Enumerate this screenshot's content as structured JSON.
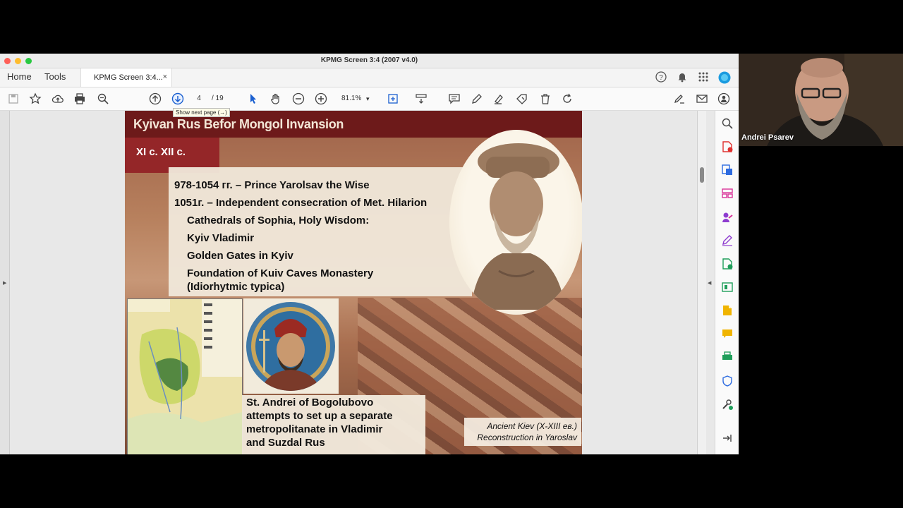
{
  "window": {
    "title": "KPMG Screen 3:4 (2007 v4.0)"
  },
  "tabs": {
    "home": "Home",
    "tools": "Tools",
    "document": "KPMG Screen 3:4...",
    "close": "×"
  },
  "toolbar": {
    "current_page": "4",
    "total_pages": "/ 19",
    "zoom": "81.1%",
    "zoom_caret": "▾",
    "tooltip": "Show next page (→)"
  },
  "slide": {
    "header": "Kyivan Rus Befor Mongol Invansion",
    "century_label": "XI c. XII c.",
    "lines": [
      "978-1054  гг. – Prince Yarolsav the Wise",
      "1051г. – Independent consecration of Met. Hilarion",
      "Cathedrals of Sophia, Holy Wisdom:",
      "Kyiv Vladimir",
      "Golden Gates in Kyiv",
      "Foundation of Kuiv Caves Monastery",
      "(Idiorhytmic typica)"
    ],
    "bottom_text": [
      "St. Andrei of Bogolubovo",
      "attempts to set up a separate",
      "metropolitanate in Vladimir",
      "and Suzdal Rus"
    ],
    "caption": [
      "Ancient Kiev (X-XIII ев.)",
      "Reconstruction in Yaroslav"
    ]
  },
  "video": {
    "participant_name": "Andrei Psarev"
  },
  "colors": {
    "header_bg": "#6d1a1a",
    "century_bg": "#942628",
    "accent_blue": "#1a73e8"
  },
  "icons": {
    "toolbar": [
      "save-icon",
      "bookmark-star-icon",
      "upload-cloud-icon",
      "print-icon",
      "search-zoom-icon",
      "prev-page-icon",
      "next-page-icon",
      "cursor-icon",
      "hand-icon",
      "zoom-out-icon",
      "zoom-in-icon",
      "fit-page-icon",
      "scroll-mode-icon",
      "comment-icon",
      "pen-icon",
      "highlight-icon",
      "sign-icon",
      "delete-icon",
      "rotate-icon",
      "sign-request-icon",
      "mail-icon",
      "share-icon"
    ],
    "right_panel": [
      "search-icon",
      "export-pdf-icon",
      "create-pdf-icon",
      "organize-pages-icon",
      "edit-pdf-icon",
      "fill-sign-icon",
      "export-icon",
      "compress-icon",
      "send-for-comments-icon",
      "comment-icon",
      "print-production-icon",
      "protect-icon",
      "more-tools-icon",
      "collapse-panel-icon"
    ]
  }
}
